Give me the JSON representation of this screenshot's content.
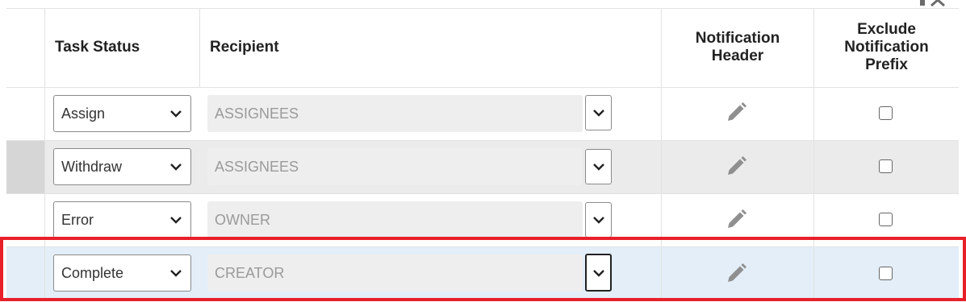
{
  "table": {
    "headers": {
      "task_status": "Task Status",
      "recipient": "Recipient",
      "notification_header_line1": "Notification",
      "notification_header_line2": "Header",
      "exclude_line1": "Exclude",
      "exclude_line2": "Notification",
      "exclude_line3": "Prefix"
    },
    "rows": [
      {
        "task_status": "Assign",
        "recipient": "ASSIGNEES",
        "exclude_checked": false
      },
      {
        "task_status": "Withdraw",
        "recipient": "ASSIGNEES",
        "exclude_checked": false
      },
      {
        "task_status": "Error",
        "recipient": "OWNER",
        "exclude_checked": false
      },
      {
        "task_status": "Complete",
        "recipient": "CREATOR",
        "exclude_checked": false
      }
    ]
  },
  "colors": {
    "row_alt_bg": "#ebebeb",
    "row_selected_bg": "#e3eef8",
    "highlight_border": "#e8202a"
  }
}
